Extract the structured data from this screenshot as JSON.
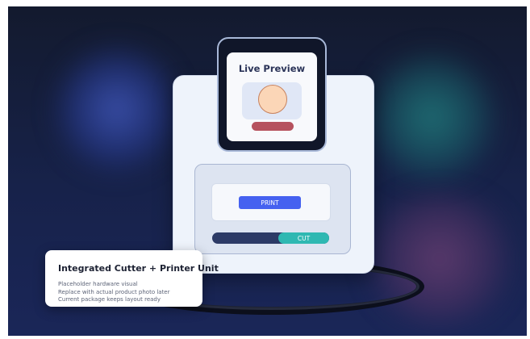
{
  "preview": {
    "title": "Live Preview"
  },
  "controls": {
    "print_label": "PRINT",
    "cut_label": "CUT"
  },
  "caption": {
    "title": "Integrated Cutter + Printer Unit",
    "lines": [
      "Placeholder hardware visual",
      "Replace with actual product photo later",
      "Current package keeps layout ready"
    ]
  },
  "colors": {
    "background": "#17224a",
    "device_body": "#eef3fb",
    "print_button": "#4561f0",
    "cut_button": "#2fb8b2",
    "name_bar": "#b6525e",
    "avatar": "#fbd6b7"
  },
  "icons": {
    "avatar": "face-circle-icon"
  }
}
